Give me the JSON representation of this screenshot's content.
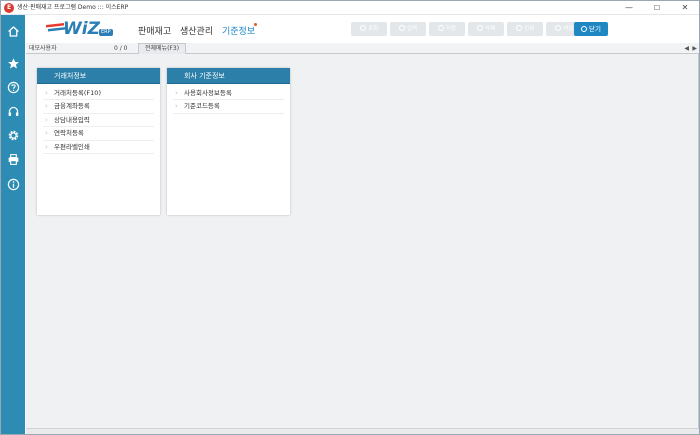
{
  "window": {
    "title": "생산·판매재고 프로그램 Demo ::: 이스ERP",
    "app_icon_glyph": "E",
    "minimize_glyph": "—",
    "maximize_glyph": "☐",
    "close_glyph": "✕"
  },
  "sidebar": {
    "items": [
      {
        "name": "home",
        "icon": "home-icon"
      },
      {
        "name": "favorites",
        "icon": "star-icon"
      },
      {
        "name": "help",
        "icon": "help-icon"
      },
      {
        "name": "support",
        "icon": "headset-icon"
      },
      {
        "name": "settings",
        "icon": "gear-icon"
      },
      {
        "name": "print",
        "icon": "printer-icon"
      },
      {
        "name": "info",
        "icon": "info-icon"
      }
    ],
    "background": "#2d8cb3"
  },
  "header": {
    "logo_text": "WiZ",
    "logo_badge": "ERP",
    "menus": [
      "판매재고",
      "생산관리",
      "기준정보"
    ],
    "active_menu_color": "#1e86c8",
    "toolbar": [
      "조회",
      "입력",
      "저장",
      "삭제",
      "인쇄",
      "엑셀",
      "닫기"
    ],
    "close_button_color": "#1f88c2"
  },
  "tabstrip": {
    "user_label": "데모사용자",
    "user_count": "0 / 0",
    "active_tab": "전체메뉴(F3)",
    "prev_glyph": "◀",
    "next_glyph": "▶"
  },
  "cards": {
    "partner": {
      "title": "거래처정보",
      "items": [
        "거래처등록(F10)",
        "금융계좌등록",
        "상담내용입력",
        "연락처등록",
        "우편라벨인쇄"
      ]
    },
    "company": {
      "title": "회사 기준정보",
      "items": [
        "사용회사정보등록",
        "기준코드등록"
      ]
    },
    "header_color": "#2b7fa8"
  }
}
